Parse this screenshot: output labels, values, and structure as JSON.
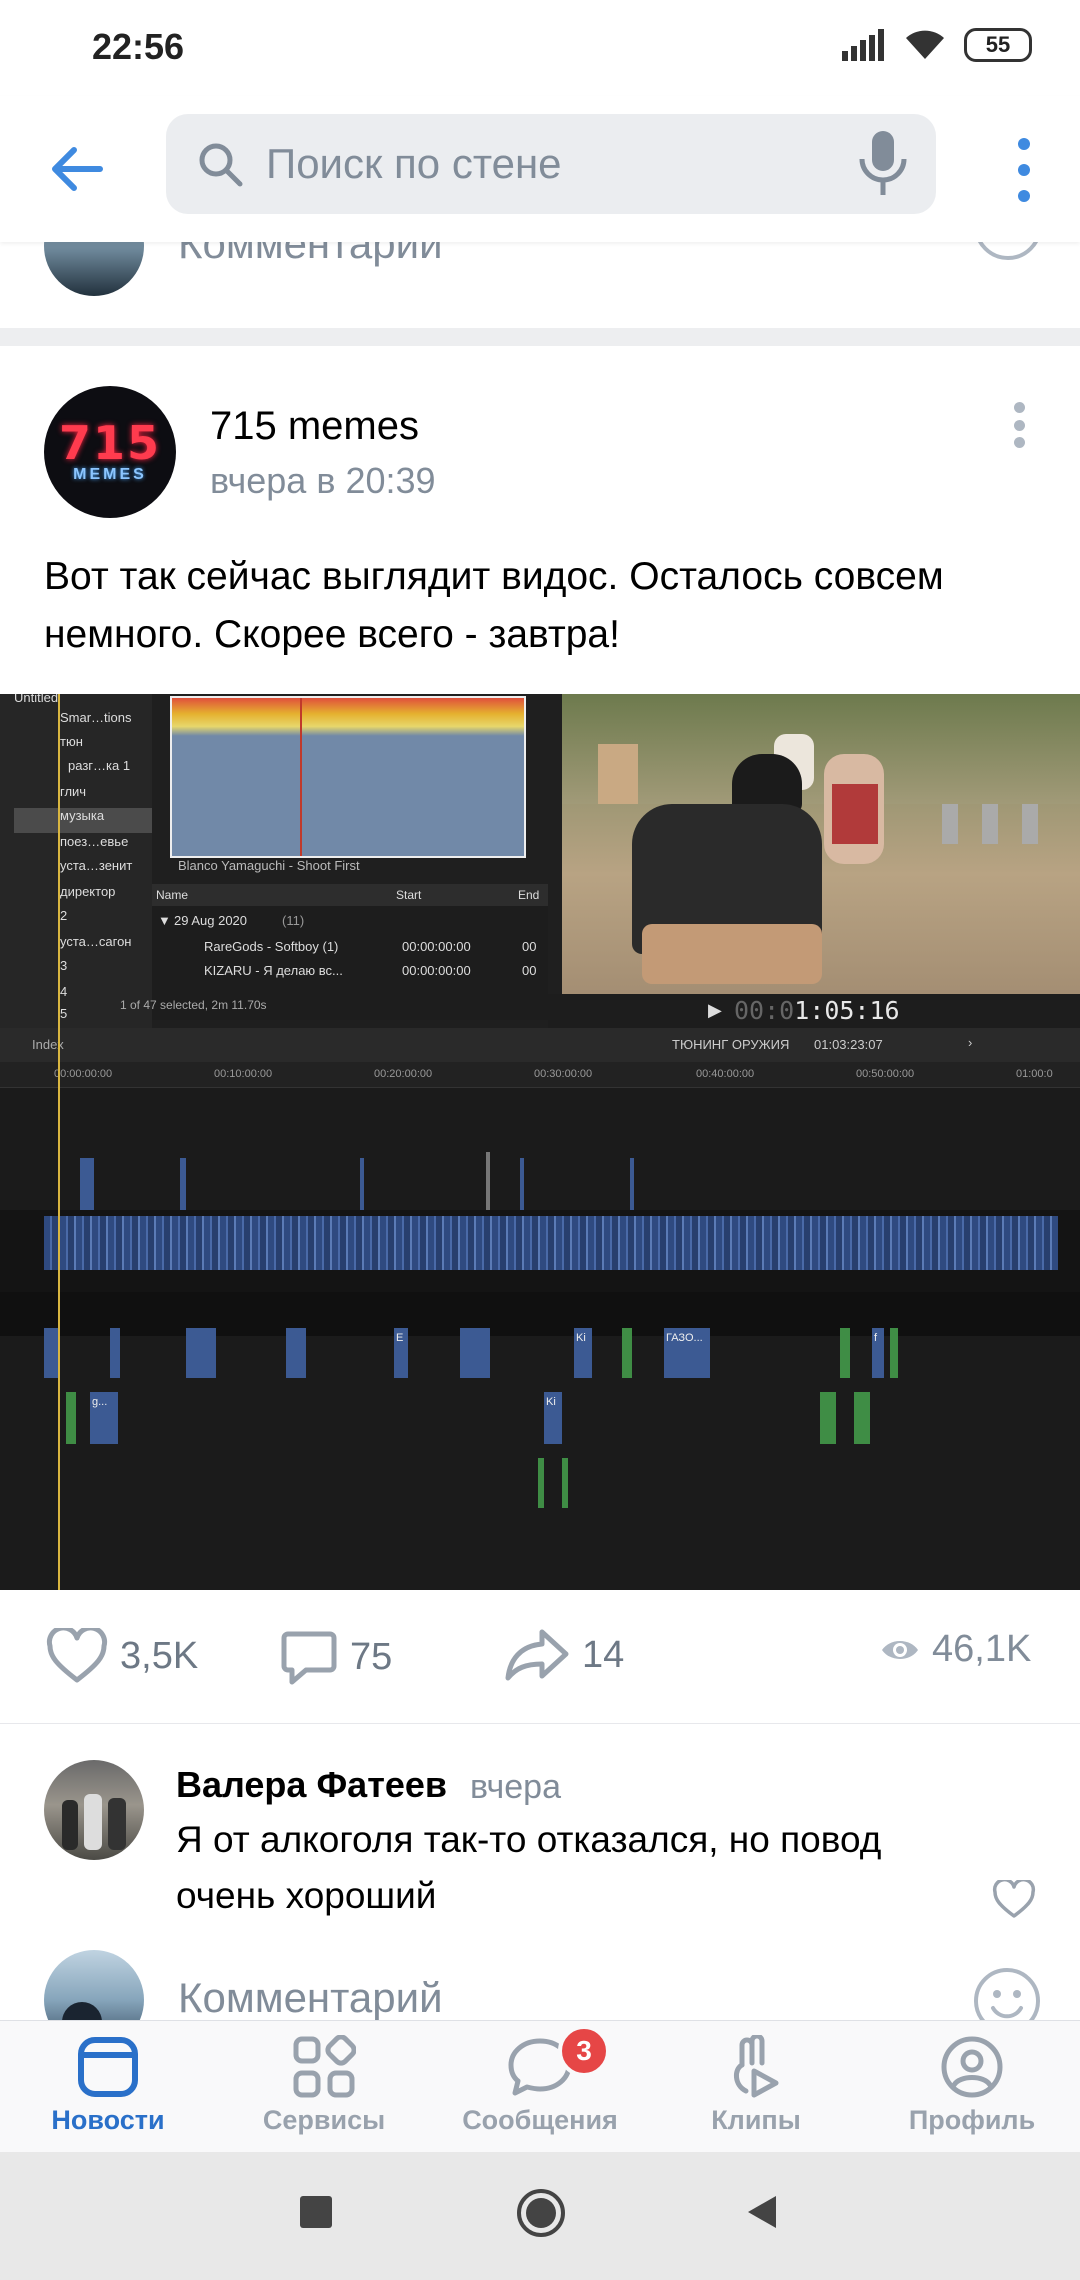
{
  "status_bar": {
    "time": "22:56",
    "battery": "55"
  },
  "header": {
    "search_placeholder": "Поиск по стене"
  },
  "prev_comment": {
    "placeholder": "Комментарий"
  },
  "post": {
    "author": "715 memes",
    "time": "вчера в 20:39",
    "text": "Вот так сейчас выглядит видос. Осталось совсем немного. Скорее всего - завтра!",
    "avatar_logo": {
      "number": "715",
      "sub": "MEMES"
    },
    "editor": {
      "library": [
        "Untitled",
        "Smar…tions",
        "тюн",
        "разг…ка 1",
        "глич",
        "музыка",
        "поез…евье",
        "уста…зенит",
        "директор",
        "2",
        "уста…сагон",
        "3",
        "4",
        "5"
      ],
      "audio_title": "Blanco Yamaguchi - Shoot First",
      "list_headers": [
        "Name",
        "Start",
        "End"
      ],
      "list_group": "29 Aug 2020",
      "list_group_count": "(11)",
      "list_rows": [
        {
          "name": "RareGods - Softboy (1)",
          "start": "00:00:00:00",
          "end": "00"
        },
        {
          "name": "KIZARU - Я делаю вс...",
          "start": "00:00:00:00",
          "end": "00"
        }
      ],
      "list_footer": "1 of 47 selected, 2m 11.70s",
      "timecode_dim": "00:0",
      "timecode": "1:05:16",
      "index_label": "Index",
      "project_name": "ТЮНИНГ ОРУЖИЯ",
      "project_duration": "01:03:23:07",
      "ruler": [
        "00:00:00:00",
        "00:10:00:00",
        "00:20:00:00",
        "00:30:00:00",
        "00:40:00:00",
        "00:50:00:00",
        "01:00:0"
      ],
      "clip_labels": [
        "E",
        "Ki",
        "ГАЗО...",
        "f",
        "g...",
        "Ki"
      ]
    },
    "likes": "3,5K",
    "comments": "75",
    "shares": "14",
    "views": "46,1K"
  },
  "comment": {
    "author": "Валера Фатеев",
    "time": "вчера",
    "text": "Я от алкоголя так-то отказался, но повод очень хороший"
  },
  "comment_input": {
    "placeholder": "Комментарий"
  },
  "tabbar": {
    "items": [
      {
        "label": "Новости"
      },
      {
        "label": "Сервисы"
      },
      {
        "label": "Сообщения",
        "badge": "3"
      },
      {
        "label": "Клипы"
      },
      {
        "label": "Профиль"
      }
    ]
  },
  "colors": {
    "accent": "#2a70c9",
    "icon_gray": "#99a2ad",
    "badge": "#e64646"
  }
}
